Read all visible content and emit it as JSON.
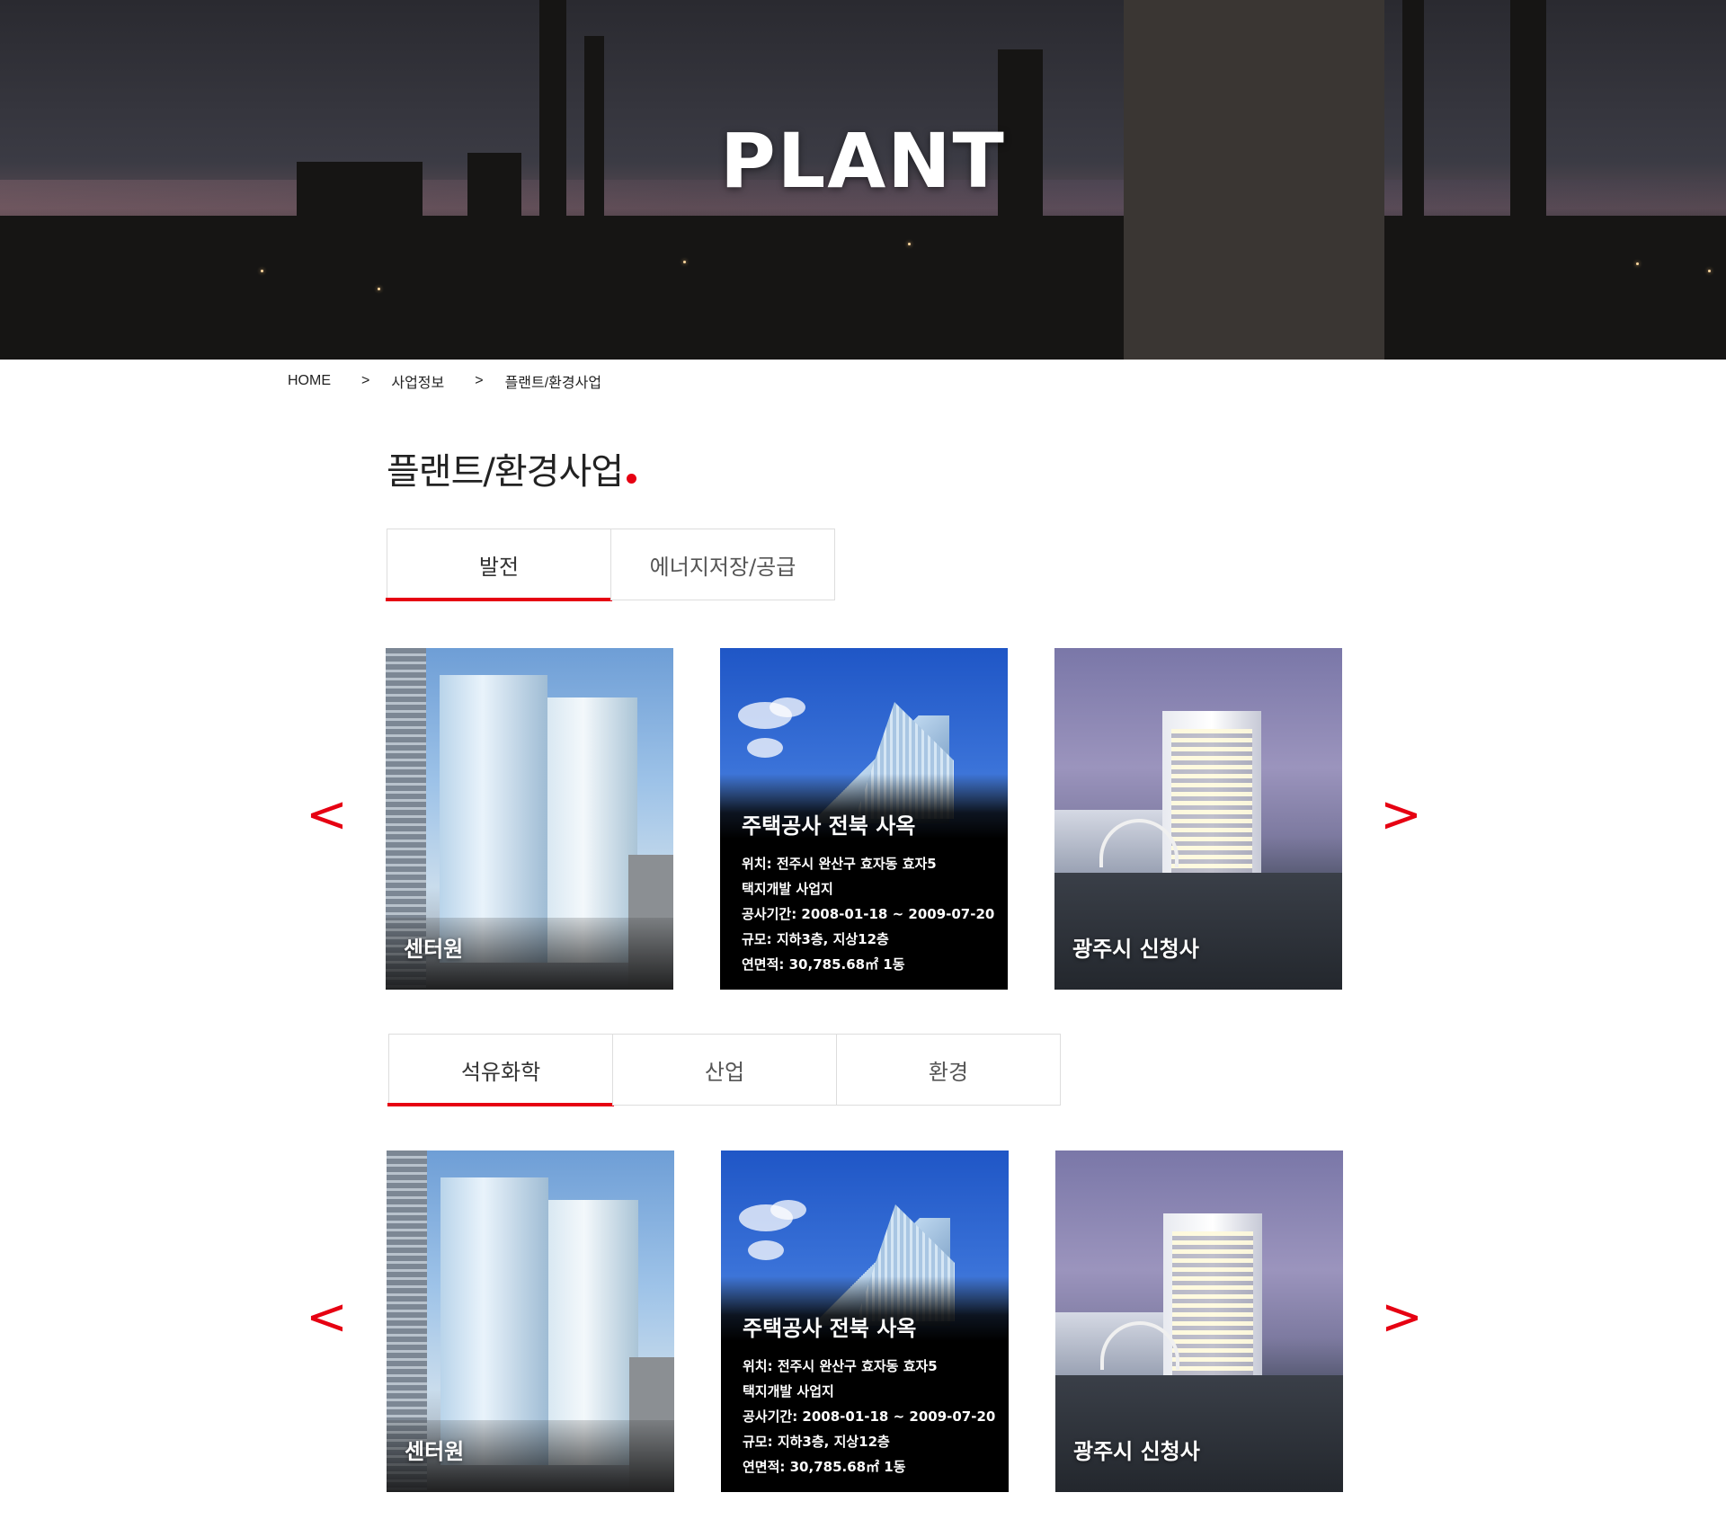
{
  "hero": {
    "title": "PLANT"
  },
  "breadcrumb": {
    "home": "HOME",
    "sep": ">",
    "level1": "사업정보",
    "level2": "플랜트/환경사업"
  },
  "section": {
    "title": "플랜트/환경사업"
  },
  "colors": {
    "accent": "#e60012"
  },
  "tabs1": [
    {
      "label": "발전",
      "active": true
    },
    {
      "label": "에너지저장/공급",
      "active": false
    }
  ],
  "tabs2": [
    {
      "label": "석유화학",
      "active": true
    },
    {
      "label": "산업",
      "active": false
    },
    {
      "label": "환경",
      "active": false
    }
  ],
  "carousel": {
    "prev": "<",
    "next": ">"
  },
  "gallery1": {
    "cards": [
      {
        "caption": "센터원"
      },
      {
        "title": "주택공사 전북 사옥",
        "lines": [
          "위치: 전주시 완산구 효자동 효자5",
          "택지개발 사업지",
          "공사기간: 2008-01-18 ~ 2009-07-20",
          "규모: 지하3층, 지상12층",
          "연면적: 30,785.68㎡  1동"
        ]
      },
      {
        "caption": "광주시 신청사"
      }
    ]
  },
  "gallery2": {
    "cards": [
      {
        "caption": "센터원"
      },
      {
        "title": "주택공사 전북 사옥",
        "lines": [
          "위치: 전주시 완산구 효자동 효자5",
          "택지개발 사업지",
          "공사기간: 2008-01-18 ~ 2009-07-20",
          "규모: 지하3층, 지상12층",
          "연면적: 30,785.68㎡  1동"
        ]
      },
      {
        "caption": "광주시 신청사"
      }
    ]
  }
}
